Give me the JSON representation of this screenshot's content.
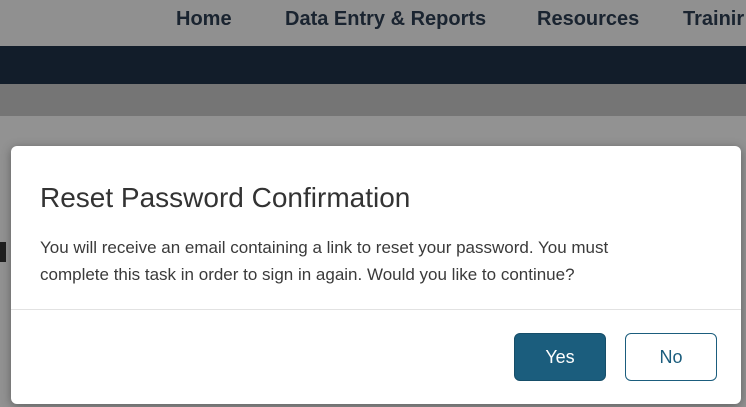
{
  "nav": {
    "items": [
      {
        "label": "Home"
      },
      {
        "label": "Data Entry & Reports"
      },
      {
        "label": "Resources"
      },
      {
        "label": "Trainir"
      }
    ]
  },
  "modal": {
    "title": "Reset Password Confirmation",
    "body_line1": "You will receive an email containing a link to reset your password.  You must",
    "body_line2": "complete this task in order to sign in again. Would you like to continue?",
    "yes_label": "Yes",
    "no_label": "No"
  },
  "colors": {
    "nav_dark": "#1d2f45",
    "primary_button": "#1b5d7d",
    "nav_text": "#2b3a4e"
  }
}
